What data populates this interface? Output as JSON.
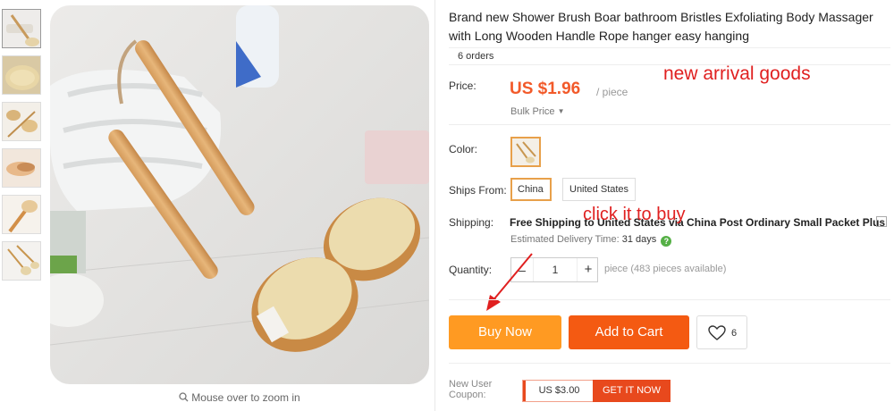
{
  "product": {
    "title": "Brand new Shower Brush Boar bathroom Bristles Exfoliating Body Massager with Long Wooden Handle Rope hanger easy hanging",
    "orders": "6 orders"
  },
  "gallery": {
    "thumbnail_count": 6,
    "zoom_hint": "Mouse over to zoom in"
  },
  "price": {
    "label": "Price:",
    "value": "US $1.96",
    "unit": "/ piece",
    "bulk_label": "Bulk Price"
  },
  "annotations": {
    "new_arrival": "new arrival goods",
    "click_to_buy": "click it to buy"
  },
  "color": {
    "label": "Color:"
  },
  "ships_from": {
    "label": "Ships From:",
    "options": [
      "China",
      "United States"
    ],
    "selected": "China"
  },
  "shipping": {
    "label": "Shipping:",
    "text": "Free Shipping to United States via China Post Ordinary Small Packet Plus",
    "est_label": "Estimated Delivery Time:",
    "est_value": "31 days"
  },
  "quantity": {
    "label": "Quantity:",
    "value": "1",
    "minus": "–",
    "plus": "+",
    "note": "piece (483 pieces available)"
  },
  "actions": {
    "buy_now": "Buy Now",
    "add_to_cart": "Add to Cart",
    "wishlist_count": "6"
  },
  "coupon": {
    "label_line1": "New User",
    "label_line2": "Coupon:",
    "amount": "US $3.00",
    "cta": "GET IT NOW"
  },
  "colors": {
    "price": "#f25a2a",
    "buy_now": "#ff9a22",
    "add_to_cart": "#f45a12",
    "annotation": "#e02020",
    "selected_border": "#e8a04a"
  }
}
